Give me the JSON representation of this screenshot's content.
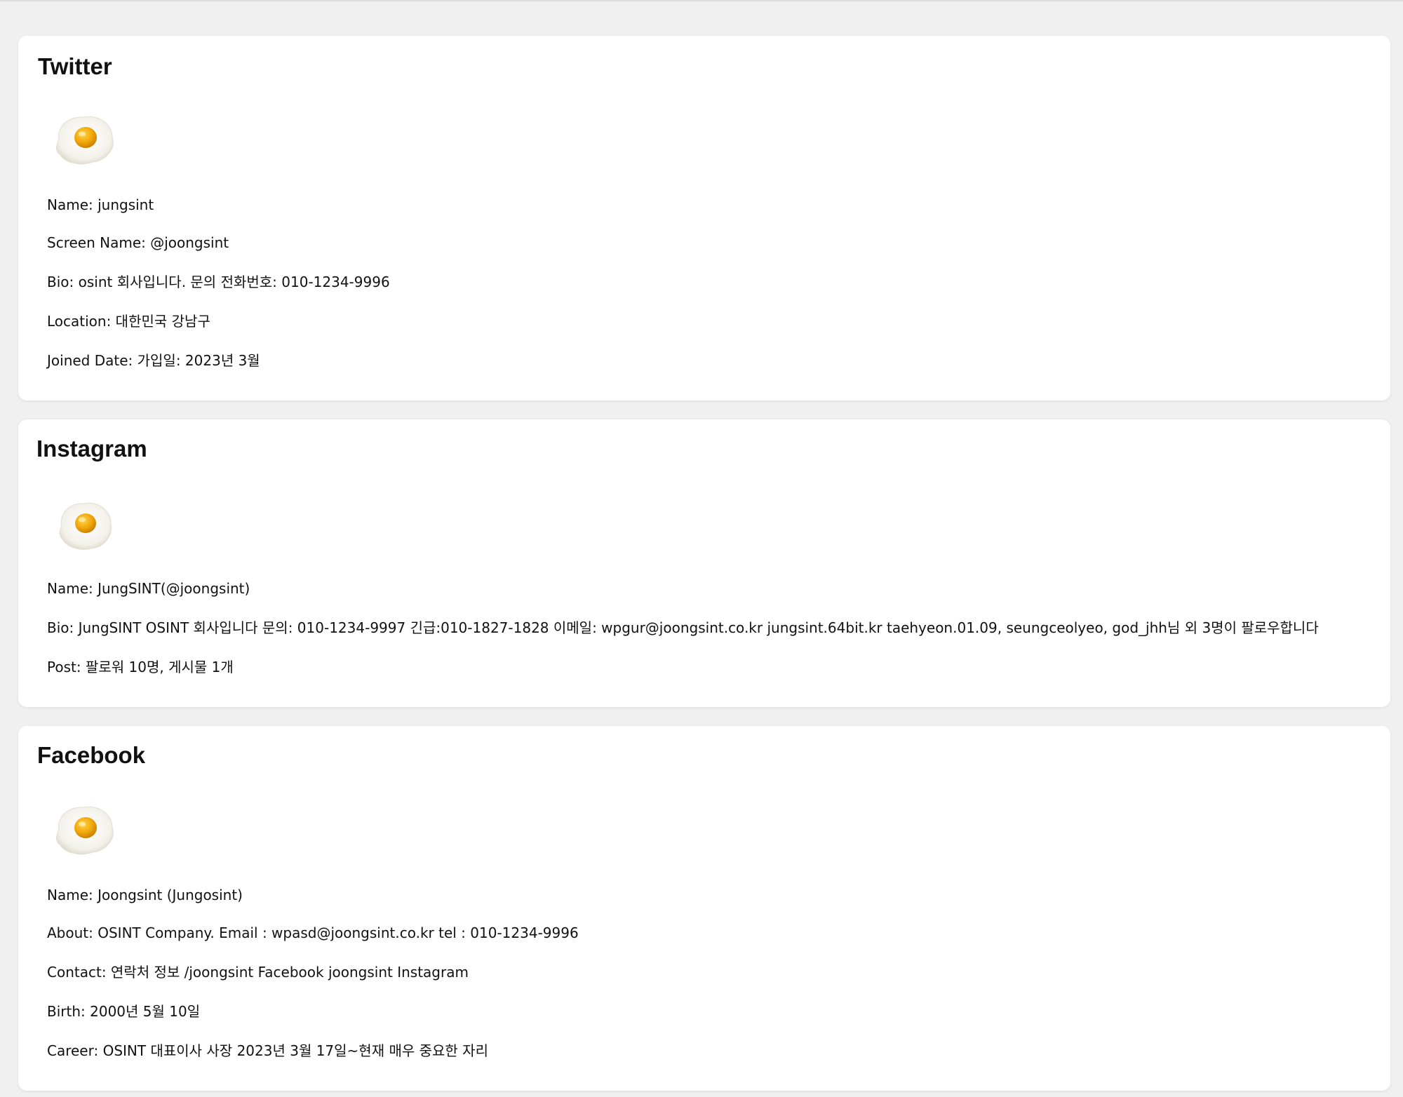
{
  "colors": {
    "page_background": "#f0f0f0",
    "card_background": "#ffffff",
    "text": "#111111"
  },
  "twitter": {
    "title": "Twitter",
    "avatar_icon": "fried-egg-avatar",
    "fields": {
      "name": "Name: jungsint",
      "screen_name": "Screen Name: @joongsint",
      "bio": "Bio: osint 회사입니다. 문의 전화번호: 010-1234-9996",
      "location": "Location: 대한민국 강남구",
      "joined": "Joined Date: 가입일: 2023년 3월"
    }
  },
  "instagram": {
    "title": "Instagram",
    "avatar_icon": "fried-egg-avatar",
    "fields": {
      "name": "Name: JungSINT(@joongsint)",
      "bio": "Bio: JungSINT OSINT 회사입니다 문의: 010-1234-9997 긴급:010-1827-1828 이메일: wpgur@joongsint.co.kr jungsint.64bit.kr taehyeon.01.09, seungceolyeo, god_jhh님 외 3명이 팔로우합니다",
      "post": "Post: 팔로워 10명, 게시물 1개"
    }
  },
  "facebook": {
    "title": "Facebook",
    "avatar_icon": "fried-egg-avatar",
    "fields": {
      "name": "Name: Joongsint (Jungosint)",
      "about": "About: OSINT Company. Email : wpasd@joongsint.co.kr tel : 010-1234-9996",
      "contact": "Contact: 연락처 정보 /joongsint Facebook joongsint Instagram",
      "birth": "Birth: 2000년 5월 10일",
      "career": "Career: OSINT 대표이사 사장 2023년 3월 17일~현재 매우 중요한 자리"
    }
  }
}
